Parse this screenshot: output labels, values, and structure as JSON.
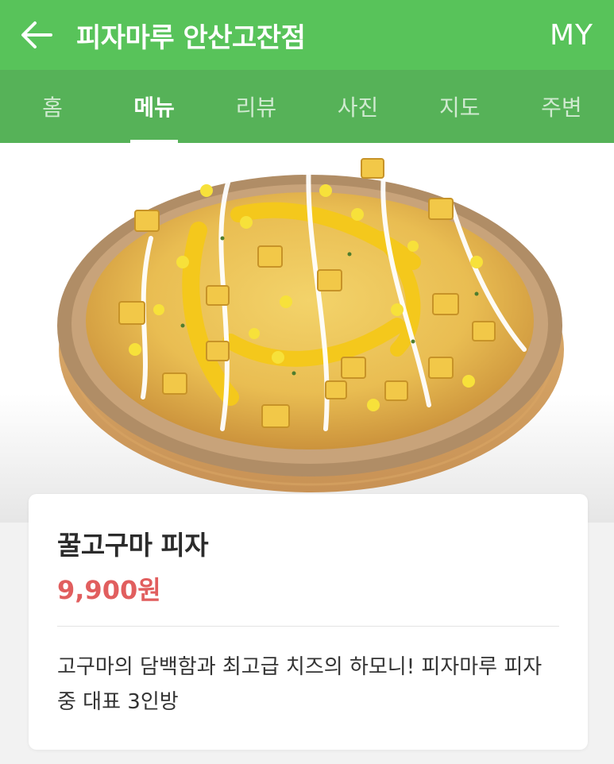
{
  "header": {
    "title": "피자마루 안산고잔점",
    "my_label": "MY",
    "back_icon": "arrow-left-icon",
    "background": "#58c35a"
  },
  "tabs": [
    {
      "label": "홈",
      "active": false
    },
    {
      "label": "메뉴",
      "active": true
    },
    {
      "label": "리뷰",
      "active": false
    },
    {
      "label": "사진",
      "active": false
    },
    {
      "label": "지도",
      "active": false
    },
    {
      "label": "주변",
      "active": false
    }
  ],
  "menu": {
    "name": "꿀고구마 피자",
    "price": "9,900원",
    "description": "고구마의 담백함과 최고급 치즈의 하모니! 피자마루 피자 중 대표 3인방",
    "price_color": "#e15e5e"
  }
}
